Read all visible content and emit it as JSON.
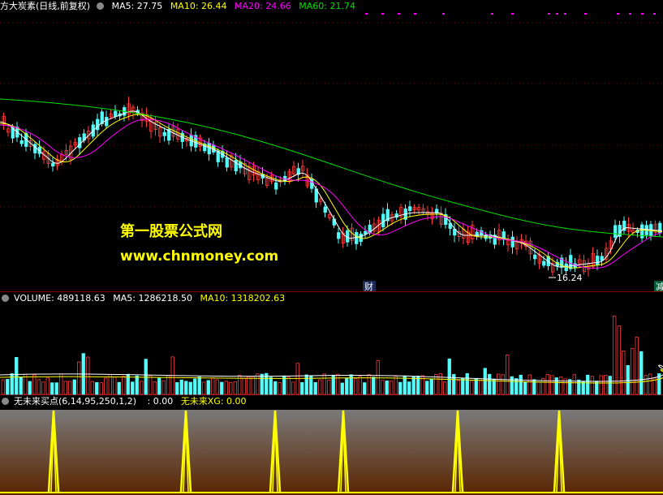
{
  "main_legend": {
    "title": "方大炭素(日线,前复权)",
    "ma5": "MA5: 27.75",
    "ma10": "MA10: 26.44",
    "ma20": "MA20: 24.66",
    "ma60": "MA60: 21.74"
  },
  "volume_legend": {
    "volume": "VOLUME: 489118.63",
    "ma5": "MA5: 1286218.50",
    "ma10": "MA10: 1318202.63"
  },
  "indicator_legend": {
    "name": "无未来买点(6,14,95,250,1,2)",
    "value": ": 0.00",
    "xg": "无未来XG: 0.00"
  },
  "price_label": "16.24",
  "markers": {
    "cai": "财",
    "jian": "减"
  },
  "watermark": {
    "line1": "第一股票公式网",
    "line2": "www.chnmoney.com"
  },
  "colors": {
    "up": "#ff3b3b",
    "down": "#54fcfc",
    "ma5": "#ffffff",
    "ma10": "#ffff00",
    "ma20": "#ff00ff",
    "ma60": "#00e000",
    "signal": "#ffff00",
    "grid": "#8b0000"
  }
}
